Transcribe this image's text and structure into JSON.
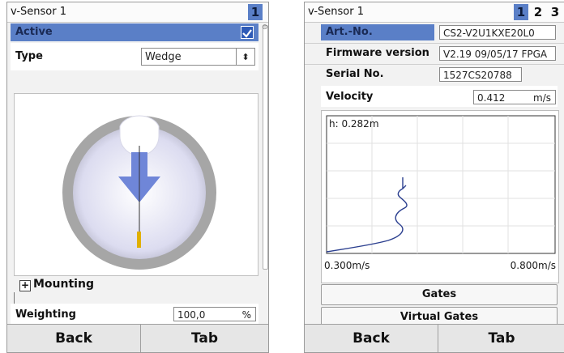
{
  "left": {
    "title": "v-Sensor 1",
    "pages": [
      "1"
    ],
    "active_label": "Active",
    "type_label": "Type",
    "type_value": "Wedge",
    "mounting_label": "Mounting",
    "weighting_label": "Weighting",
    "weighting_value": "100,0",
    "weighting_unit": "%",
    "back": "Back",
    "tab": "Tab"
  },
  "right": {
    "title": "v-Sensor 1",
    "pages": [
      "1",
      "2",
      "3"
    ],
    "art_no_label": "Art.-No.",
    "art_no_value": "CS2-V2U1KXE20L0",
    "firmware_label": "Firmware version",
    "firmware_value": "V2.19 09/05/17 FPGA",
    "serial_label": "Serial No.",
    "serial_value": "1527CS20788",
    "velocity_label": "Velocity",
    "velocity_value": "0.412",
    "velocity_unit": "m/s",
    "plot_height": "h: 0.282m",
    "plot_xmin": "0.300m/s",
    "plot_xmax": "0.800m/s",
    "gates": "Gates",
    "virtual_gates": "Virtual Gates",
    "back": "Back",
    "tab": "Tab"
  },
  "colors": {
    "active_selected": "#5a7fc7",
    "checkbox": "#2f5bb7",
    "pipe": "#a9a9a9",
    "flow_arrow": "#6f86d8",
    "sensor_tip": "#e0b000",
    "profile_line": "#2b3f8f"
  }
}
